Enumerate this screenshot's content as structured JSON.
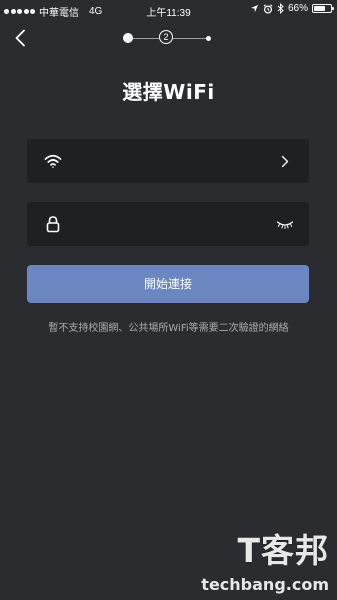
{
  "status_bar": {
    "carrier": "中華電信",
    "network": "4G",
    "time": "上午11:39",
    "battery_text": "66%",
    "battery_level": 0.66,
    "icons": [
      "location-arrow-icon",
      "alarm-icon",
      "bluetooth-icon",
      "battery-icon"
    ]
  },
  "stepper": {
    "current_step": "2"
  },
  "title": "選擇WiFi",
  "wifi_field": {
    "value": "",
    "left_icon": "wifi-icon",
    "right_icon": "chevron-right-icon"
  },
  "password_field": {
    "value": "",
    "placeholder": "",
    "left_icon": "lock-icon",
    "right_icon": "eye-closed-icon"
  },
  "connect_button": {
    "label": "開始連接",
    "color": "#6b86c1"
  },
  "note": "暫不支持校園網、公共場所WiFi等需要二次驗證的網絡",
  "watermark": {
    "logo": "T客邦",
    "domain": "techbang.com"
  },
  "colors": {
    "background": "#2a2c30",
    "field_background": "#1f2023",
    "note_text": "#a9abaf"
  }
}
